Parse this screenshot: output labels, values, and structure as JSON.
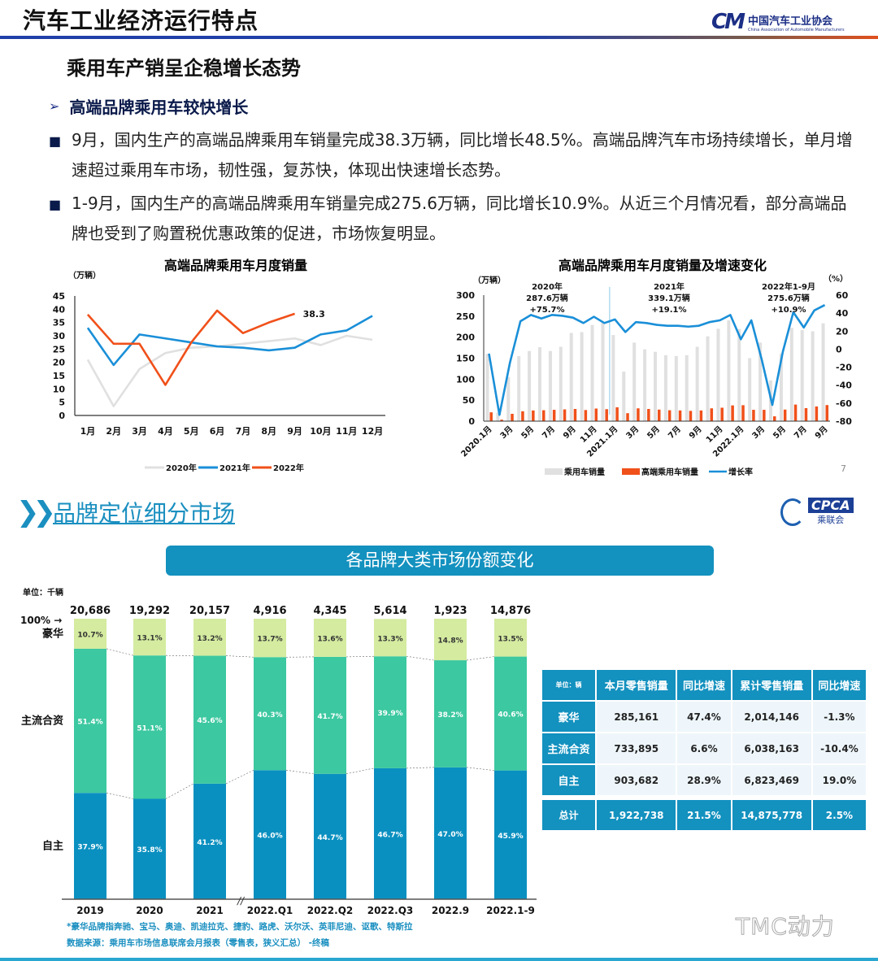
{
  "header": {
    "title": "汽车工业经济运行特点",
    "logo_mark": "CM",
    "logo_cn": "中国汽车工业协会",
    "logo_en": "China Association of Automobile Manufacturers"
  },
  "subtitle": "乘用车产销呈企稳增长态势",
  "section1": {
    "heading": "高端品牌乘用车较快增长",
    "bullets": [
      "9月，国内生产的高端品牌乘用车销量完成38.3万辆，同比增长48.5%。高端品牌汽车市场持续增长，单月增速超过乘用车市场，韧性强，复苏快，体现出快速增长态势。",
      "1-9月，国内生产的高端品牌乘用车销量完成275.6万辆，同比增长10.9%。从近三个月情况看，部分高端品牌也受到了购置税优惠政策的促进，市场恢复明显。"
    ]
  },
  "page_number": "7",
  "section2": {
    "heading": "品牌定位细分市场",
    "logo_en": "CPCA",
    "logo_cn": "乘联会",
    "banner": "各品牌大类市场份额变化",
    "unit": "单位：千辆",
    "footnote": "*豪华品牌指奔驰、宝马、奥迪、凯迪拉克、捷豹、路虎、沃尔沃、英菲尼迪、讴歌、特斯拉",
    "source": "数据来源：乘用车市场信息联席会月报表（零售表，狭义汇总） -终稿"
  },
  "table": {
    "headers": [
      "单位：辆",
      "本月零售销量",
      "同比增速",
      "累计零售销量",
      "同比增速"
    ],
    "rows": [
      [
        "豪华",
        "285,161",
        "47.4%",
        "2,014,146",
        "-1.3%"
      ],
      [
        "主流合资",
        "733,895",
        "6.6%",
        "6,038,163",
        "-10.4%"
      ],
      [
        "自主",
        "903,682",
        "28.9%",
        "6,823,469",
        "19.0%"
      ]
    ],
    "total": [
      "总计",
      "1,922,738",
      "21.5%",
      "14,875,778",
      "2.5%"
    ]
  },
  "watermark": "TMC动力",
  "colors": {
    "blue": "#1a8fc0",
    "orange": "#f0501a",
    "gray": "#e0e0e0",
    "luxury": "#d4eba0",
    "mainstream": "#3cc8a0",
    "domestic": "#0a90c0"
  },
  "chart_data": [
    {
      "type": "line",
      "title": "高端品牌乘用车月度销量",
      "ylabel": "（万辆）",
      "ylim": [
        0,
        45
      ],
      "yticks": [
        0,
        5,
        10,
        15,
        20,
        25,
        30,
        35,
        40,
        45
      ],
      "categories": [
        "1月",
        "2月",
        "3月",
        "4月",
        "5月",
        "6月",
        "7月",
        "8月",
        "9月",
        "10月",
        "11月",
        "12月"
      ],
      "series": [
        {
          "name": "2020年",
          "color": "#e0e0e0",
          "values": [
            21,
            3.5,
            17.5,
            23.5,
            25.5,
            26,
            27,
            28,
            29,
            26.5,
            30,
            28.5
          ]
        },
        {
          "name": "2021年",
          "color": "#1a8fd8",
          "values": [
            33,
            19,
            30.5,
            29,
            27.5,
            26,
            25.5,
            24.5,
            25.5,
            30.5,
            32,
            37.5
          ]
        },
        {
          "name": "2022年",
          "color": "#f0501a",
          "values": [
            38,
            27,
            27,
            11.5,
            27.5,
            39.5,
            31,
            35,
            38.3
          ]
        }
      ],
      "annotation": "38.3"
    },
    {
      "type": "bar",
      "title": "高端品牌乘用车月度销量及增速变化",
      "ylabel": "（万辆）",
      "y2label": "（%）",
      "ylim": [
        0,
        300
      ],
      "y2lim": [
        -80,
        60
      ],
      "yticks": [
        0,
        50,
        100,
        150,
        200,
        250,
        300
      ],
      "y2ticks": [
        -80,
        -60,
        -40,
        -20,
        0,
        20,
        40,
        60
      ],
      "xticklabels": [
        "2020.1月",
        "3月",
        "5月",
        "7月",
        "9月",
        "11月",
        "2021.1月",
        "3月",
        "5月",
        "7月",
        "9月",
        "11月",
        "2022.1月",
        "3月",
        "5月",
        "7月",
        "9月"
      ],
      "months": [
        "2020.1",
        "2020.2",
        "2020.3",
        "2020.4",
        "2020.5",
        "2020.6",
        "2020.7",
        "2020.8",
        "2020.9",
        "2020.10",
        "2020.11",
        "2020.12",
        "2021.1",
        "2021.2",
        "2021.3",
        "2021.4",
        "2021.5",
        "2021.6",
        "2021.7",
        "2021.8",
        "2021.9",
        "2021.10",
        "2021.11",
        "2021.12",
        "2022.1",
        "2022.2",
        "2022.3",
        "2022.4",
        "2022.5",
        "2022.6",
        "2022.7",
        "2022.8",
        "2022.9"
      ],
      "series": [
        {
          "name": "乘用车销量",
          "type": "bar",
          "values": [
            160,
            20,
            105,
            155,
            167,
            176,
            167,
            177,
            210,
            212,
            229,
            236,
            205,
            118,
            187,
            171,
            165,
            157,
            155,
            157,
            177,
            202,
            220,
            240,
            219,
            150,
            187,
            97,
            161,
            222,
            217,
            214,
            233
          ]
        },
        {
          "name": "高端乘用车销量",
          "type": "bar",
          "values": [
            21,
            3.5,
            17.5,
            23.5,
            25.5,
            26,
            27,
            28,
            29,
            26.5,
            30,
            28.5,
            33,
            19,
            30.5,
            29,
            27.5,
            26,
            25.5,
            24.5,
            25.5,
            30.5,
            32,
            37.5,
            38,
            27,
            27,
            11.5,
            27.5,
            39.5,
            31,
            35,
            38.3
          ]
        },
        {
          "name": "增长率",
          "type": "line",
          "axis": "right",
          "values": [
            -5,
            -73,
            -15,
            31,
            38,
            34,
            38,
            37,
            35,
            29,
            36,
            29,
            33,
            19,
            30,
            29,
            27,
            26,
            26,
            25,
            26,
            30,
            32,
            38,
            11,
            32,
            -12,
            -62,
            -3,
            41,
            24,
            43,
            49
          ]
        }
      ],
      "annotations": [
        {
          "lines": [
            "2020年",
            "287.6万辆",
            "+75.7%"
          ]
        },
        {
          "lines": [
            "2021年",
            "339.1万辆",
            "+19.1%"
          ]
        },
        {
          "lines": [
            "2022年1-9月",
            "275.6万辆",
            "+10.9%"
          ]
        }
      ]
    },
    {
      "type": "bar",
      "subtype": "stacked-100",
      "title": "各品牌大类市场份额变化",
      "unit": "单位：千辆",
      "categories": [
        "2019",
        "2020",
        "2021",
        "2022.Q1",
        "2022.Q2",
        "2022.Q3",
        "2022.9",
        "2022.1-9"
      ],
      "totals": [
        "20,686",
        "19,292",
        "20,157",
        "4,916",
        "4,345",
        "5,614",
        "1,923",
        "14,876"
      ],
      "top_label": "100%",
      "series": [
        {
          "name": "自主",
          "values": [
            37.9,
            35.8,
            41.2,
            46.0,
            44.7,
            46.7,
            47.0,
            45.9
          ]
        },
        {
          "name": "主流合资",
          "values": [
            51.4,
            51.1,
            45.6,
            40.3,
            41.7,
            39.9,
            38.2,
            40.6
          ]
        },
        {
          "name": "豪华",
          "values": [
            10.7,
            13.1,
            13.2,
            13.7,
            13.6,
            13.3,
            14.8,
            13.5
          ]
        }
      ],
      "axis_break_after": "2021"
    }
  ]
}
